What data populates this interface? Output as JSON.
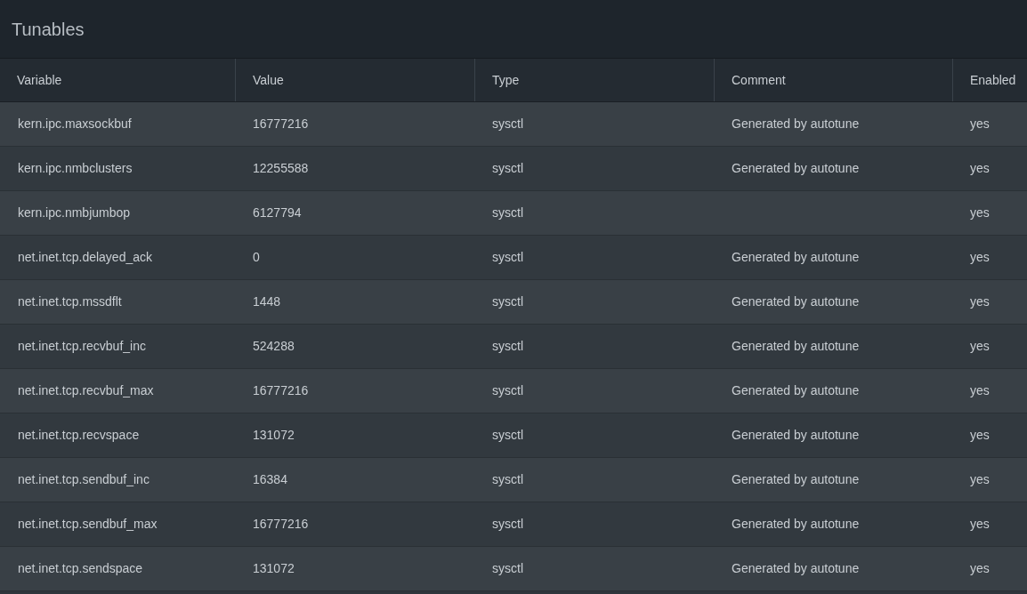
{
  "title": "Tunables",
  "table": {
    "columns": [
      "Variable",
      "Value",
      "Type",
      "Comment",
      "Enabled"
    ],
    "rows": [
      [
        "kern.ipc.maxsockbuf",
        "16777216",
        "sysctl",
        "Generated by autotune",
        "yes"
      ],
      [
        "kern.ipc.nmbclusters",
        "12255588",
        "sysctl",
        "Generated by autotune",
        "yes"
      ],
      [
        "kern.ipc.nmbjumbop",
        "6127794",
        "sysctl",
        "",
        "yes"
      ],
      [
        "net.inet.tcp.delayed_ack",
        "0",
        "sysctl",
        "Generated by autotune",
        "yes"
      ],
      [
        "net.inet.tcp.mssdflt",
        "1448",
        "sysctl",
        "Generated by autotune",
        "yes"
      ],
      [
        "net.inet.tcp.recvbuf_inc",
        "524288",
        "sysctl",
        "Generated by autotune",
        "yes"
      ],
      [
        "net.inet.tcp.recvbuf_max",
        "16777216",
        "sysctl",
        "Generated by autotune",
        "yes"
      ],
      [
        "net.inet.tcp.recvspace",
        "131072",
        "sysctl",
        "Generated by autotune",
        "yes"
      ],
      [
        "net.inet.tcp.sendbuf_inc",
        "16384",
        "sysctl",
        "Generated by autotune",
        "yes"
      ],
      [
        "net.inet.tcp.sendbuf_max",
        "16777216",
        "sysctl",
        "Generated by autotune",
        "yes"
      ],
      [
        "net.inet.tcp.sendspace",
        "131072",
        "sysctl",
        "Generated by autotune",
        "yes"
      ]
    ]
  }
}
